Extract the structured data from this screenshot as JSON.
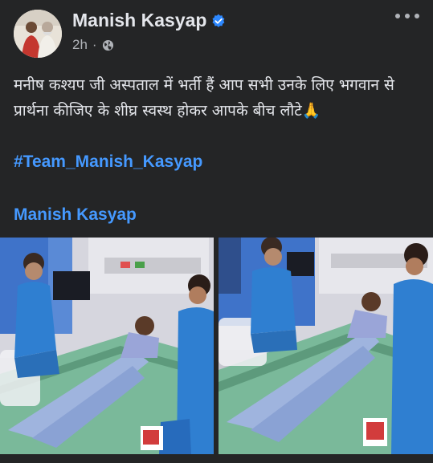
{
  "post": {
    "author": "Manish Kasyap",
    "time": "2h",
    "separator": "·",
    "text": "मनीष कश्यप जी अस्पताल में भर्ती हैं आप सभी उनके लिए भगवान से प्रार्थना कीजिए के शीघ्र स्वस्थ होकर आपके बीच लौटे🙏",
    "hashtag": "#Team_Manish_Kasyap",
    "mention": "Manish Kasyap"
  },
  "icons": {
    "verified": "verified-badge-icon",
    "privacy": "globe-icon",
    "more": "more-options-icon"
  },
  "colors": {
    "background": "#242526",
    "text": "#e4e6eb",
    "secondary_text": "#b0b3b8",
    "link": "#4599ff",
    "verified": "#2d88ff"
  }
}
